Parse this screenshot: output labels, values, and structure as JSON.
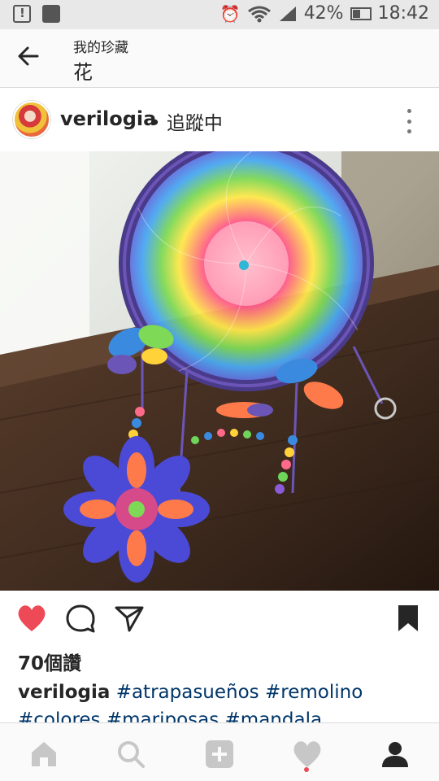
{
  "status_bar": {
    "battery": "42%",
    "time": "18:42",
    "icons": [
      "alert-icon",
      "image-icon",
      "alarm-icon",
      "wifi-icon",
      "signal-icon",
      "battery-icon"
    ]
  },
  "header": {
    "subtitle": "我的珍藏",
    "title": "花"
  },
  "post": {
    "username": "verilogia",
    "following": "• 追蹤中",
    "likes": "70個讚",
    "caption_user": "verilogia",
    "tags_line1": [
      "#atrapasueños",
      "#remolino"
    ],
    "tags_line2": [
      "#colores",
      "#mariposas",
      "#mandala"
    ]
  },
  "colors": {
    "like_red": "#ed4956",
    "hashtag": "#003569",
    "nav_inactive": "#c7c7c7",
    "nav_active": "#262626"
  },
  "nav": {
    "items": [
      "home-icon",
      "search-icon",
      "add-icon",
      "activity-icon",
      "profile-icon"
    ]
  }
}
